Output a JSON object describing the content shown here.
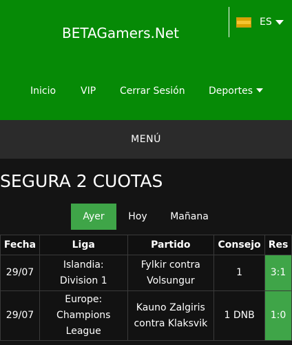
{
  "header": {
    "brand": "BETAGamers.Net",
    "lang_code": "ES",
    "nav": [
      "Inicio",
      "VIP",
      "Cerrar Sesión",
      "Deportes"
    ]
  },
  "menu": {
    "label": "MENÚ"
  },
  "page": {
    "title": "SEGURA 2 CUOTAS"
  },
  "tabs": [
    "Ayer",
    "Hoy",
    "Mañana"
  ],
  "table": {
    "headers": [
      "Fecha",
      "Liga",
      "Partido",
      "Consejo",
      "Res"
    ],
    "rows": [
      {
        "fecha": "29/07",
        "liga": [
          "Islandia:",
          "Division 1"
        ],
        "partido": [
          "Fylkir contra",
          "Volsungur"
        ],
        "consejo": "1",
        "res": "3:1"
      },
      {
        "fecha": "29/07",
        "liga": [
          "Europe:",
          "Champions",
          "League"
        ],
        "partido": [
          "Kauno Zalgiris",
          "contra Klaksvik"
        ],
        "consejo": "1 DNB",
        "res": "1:0"
      }
    ]
  },
  "colors": {
    "header_green": "#068a06",
    "accent_green": "#3fa548",
    "menu_bar": "#2b2b2b",
    "background": "#141414"
  },
  "icons": {
    "flag": "spain-flag-icon",
    "dropdown": "caret-down-icon"
  }
}
